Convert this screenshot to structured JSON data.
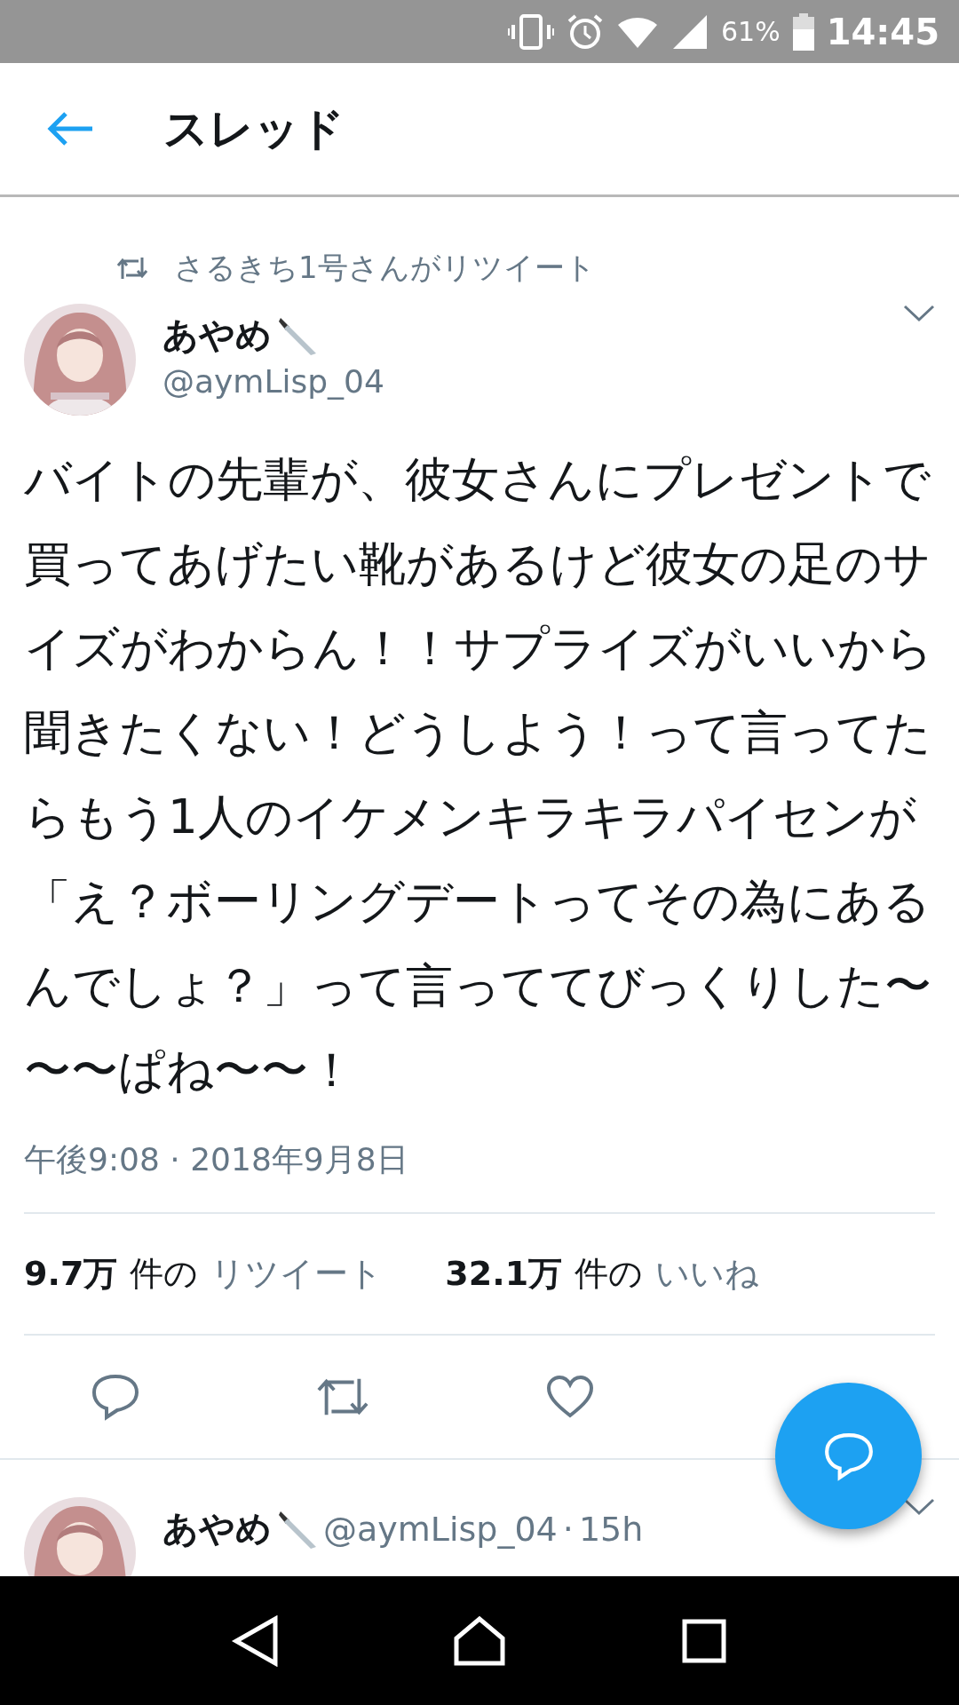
{
  "status_bar": {
    "battery": "61%",
    "time": "14:45"
  },
  "header": {
    "title": "スレッド"
  },
  "tweet": {
    "retweeted_by": "さるきち1号さんがリツイート",
    "name": "あやめ",
    "handle": "@aymLisp_04",
    "text": "バイトの先輩が、彼女さんにプレゼントで買ってあげたい靴があるけど彼女の足のサイズがわからん！！サプライズがいいから聞きたくない！どうしよう！って言ってたらもう1人のイケメンキラキラパイセンが「え？ボーリングデートってその為にあるんでしょ？」って言っててびっくりした〜〜〜ぱね〜〜！",
    "timestamp": "午後9:08 · 2018年9月8日",
    "stats": [
      {
        "count": "9.7万",
        "unit": "件の",
        "label": "リツイート"
      },
      {
        "count": "32.1万",
        "unit": "件の",
        "label": "いいね"
      }
    ]
  },
  "reply": {
    "name": "あやめ",
    "handle": "@aymLisp_04",
    "separator": "·",
    "time": "15h"
  }
}
